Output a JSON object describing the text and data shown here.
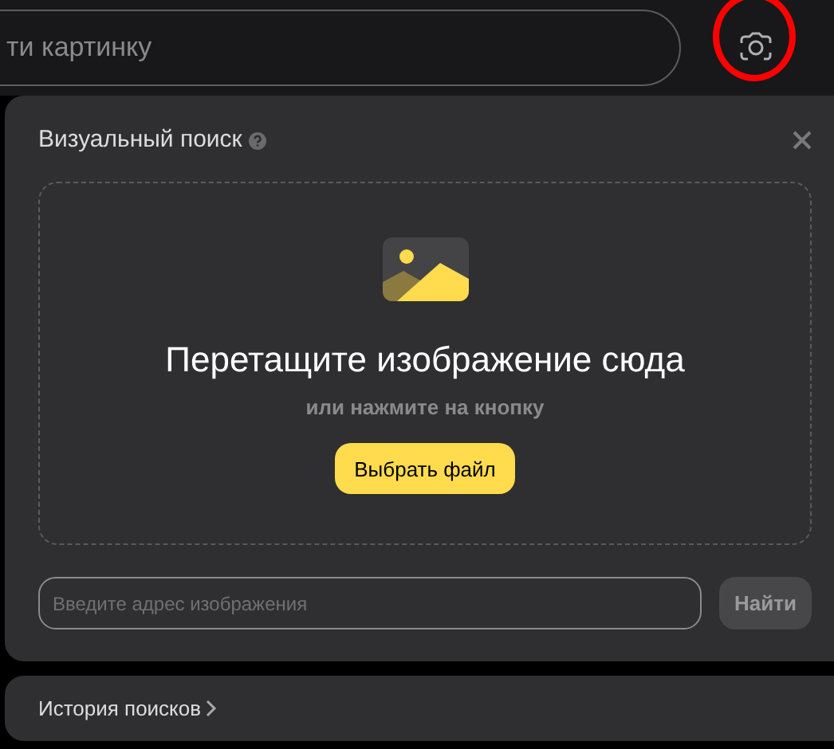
{
  "search": {
    "placeholder": "ти картинку"
  },
  "visual_search": {
    "title": "Визуальный поиск",
    "drop_zone": {
      "heading": "Перетащите изображение сюда",
      "hint": "или нажмите на кнопку",
      "button": "Выбрать файл"
    },
    "url_field": {
      "placeholder": "Введите адрес изображения"
    },
    "find_button": "Найти"
  },
  "history_link": "История поисков"
}
